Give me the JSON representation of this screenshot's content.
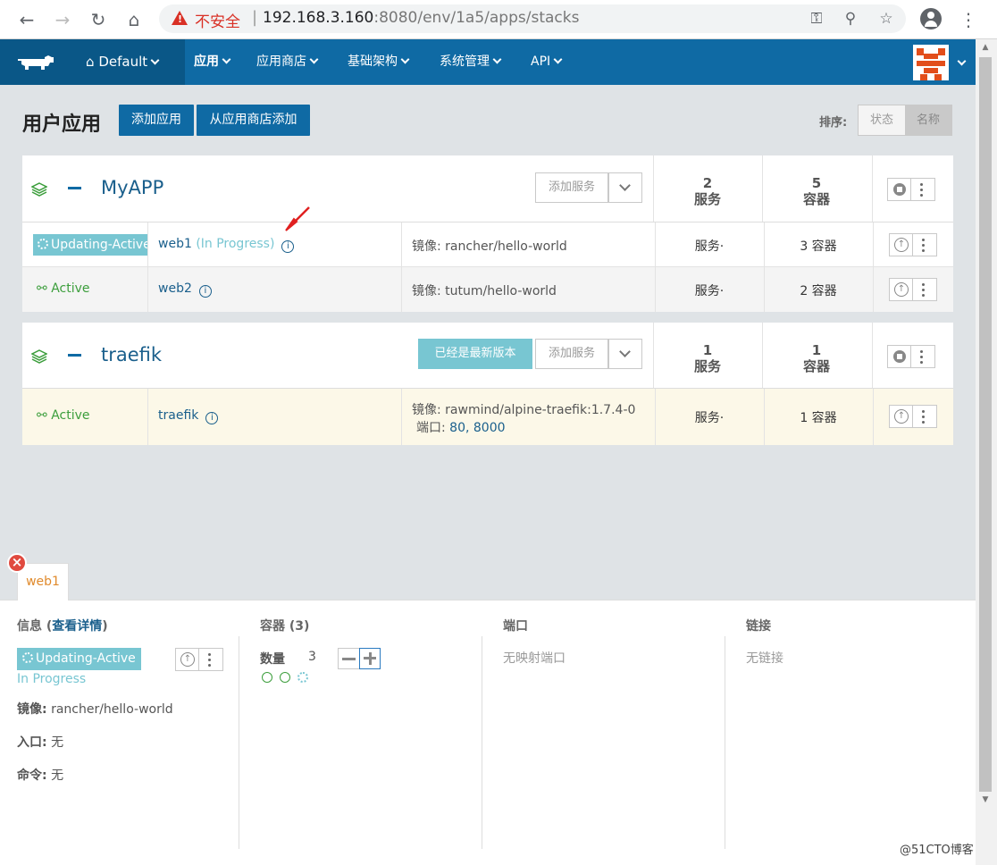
{
  "browser": {
    "insecure_label": "不安全",
    "url_host": "192.168.3.160",
    "url_rest": ":8080/env/1a5/apps/stacks",
    "back_icon": "arrow-left-icon",
    "forward_icon": "arrow-right-icon",
    "reload_icon": "reload-icon",
    "home_icon": "home-icon"
  },
  "topnav": {
    "environment": "Default",
    "items": [
      {
        "label": "应用",
        "active": true
      },
      {
        "label": "应用商店"
      },
      {
        "label": "基础架构"
      },
      {
        "label": "系统管理"
      },
      {
        "label": "API"
      }
    ]
  },
  "header": {
    "title": "用户应用",
    "add_app": "添加应用",
    "add_from_catalog": "从应用商店添加",
    "sort_label": "排序:",
    "sort_options": [
      "状态",
      "名称"
    ],
    "sort_selected": "名称"
  },
  "stacks": [
    {
      "name": "MyAPP",
      "add_service": "添加服务",
      "service_count": "2",
      "service_label": "服务",
      "container_count": "5",
      "container_label": "容器",
      "services": [
        {
          "state": "Updating-Active",
          "name": "web1",
          "progress": "(In Progress)",
          "image": "镜像: rancher/hello-world",
          "kind": "服务·",
          "containers": "3 容器"
        },
        {
          "state": "Active",
          "name": "web2",
          "image": "镜像: tutum/hello-world",
          "kind": "服务·",
          "containers": "2 容器"
        }
      ]
    },
    {
      "name": "traefik",
      "upgrade": "已经是最新版本",
      "add_service": "添加服务",
      "service_count": "1",
      "service_label": "服务",
      "container_count": "1",
      "container_label": "容器",
      "services": [
        {
          "state": "Active",
          "name": "traefik",
          "image": "镜像: rawmind/alpine-traefik:1.7.4-0",
          "ports_label": "端口:",
          "ports": "80, 8000",
          "kind": "服务·",
          "containers": "1 容器"
        }
      ]
    }
  ],
  "detail": {
    "tab": "web1",
    "info_title": "信息",
    "info_link": "查看详情",
    "state": "Updating-Active",
    "progress": "In Progress",
    "image_label": "镜像:",
    "image": "rancher/hello-world",
    "entry_label": "入口:",
    "entry": "无",
    "command_label": "命令:",
    "command": "无",
    "containers_title": "容器 (3)",
    "quantity_label": "数量",
    "quantity": "3",
    "ports_title": "端口",
    "ports_none": "无映射端口",
    "links_title": "链接",
    "links_none": "无链接"
  },
  "watermark": "@51CTO博客",
  "colors": {
    "nav": "#0f6aa4",
    "nav_dark": "#0a5787",
    "updating": "#78c6d2",
    "active": "#3c9e3c"
  }
}
